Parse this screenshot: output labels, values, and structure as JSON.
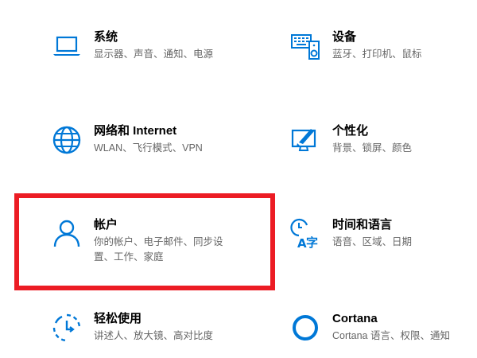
{
  "accent_color": "#0078d7",
  "highlight_color": "#ec1c24",
  "tiles": [
    {
      "icon": "laptop-icon",
      "title": "系统",
      "desc": [
        "显示器、声音、通知、电源"
      ]
    },
    {
      "icon": "keyboard-speaker-icon",
      "title": "设备",
      "desc": [
        "蓝牙、打印机、鼠标"
      ]
    },
    {
      "icon": "globe-icon",
      "title": "网络和 Internet",
      "desc": [
        "WLAN、飞行模式、VPN"
      ]
    },
    {
      "icon": "personalization-icon",
      "title": "个性化",
      "desc": [
        "背景、锁屏、颜色"
      ]
    },
    {
      "icon": "person-icon",
      "title": "帐户",
      "desc": [
        "你的帐户、电子邮件、同步设",
        "置、工作、家庭"
      ]
    },
    {
      "icon": "time-language-icon",
      "title": "时间和语言",
      "desc": [
        "语音、区域、日期"
      ]
    },
    {
      "icon": "ease-of-access-icon",
      "title": "轻松使用",
      "desc": [
        "讲述人、放大镜、高对比度"
      ]
    },
    {
      "icon": "cortana-icon",
      "title": "Cortana",
      "desc": [
        "Cortana 语言、权限、通知"
      ]
    }
  ]
}
